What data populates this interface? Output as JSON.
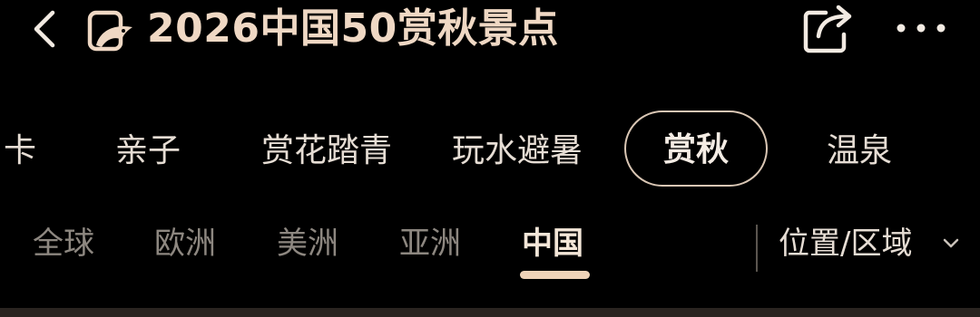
{
  "header": {
    "title": "2026中国50赏秋景点",
    "back_icon": "chevron-left-icon",
    "logo_icon": "dolphin-logo-icon",
    "share_icon": "share-icon",
    "more_icon": "more-horizontal-icon"
  },
  "category_tabs": [
    {
      "label": "卡"
    },
    {
      "label": "亲子"
    },
    {
      "label": "赏花踏青"
    },
    {
      "label": "玩水避暑"
    },
    {
      "label": "赏秋",
      "active": true
    },
    {
      "label": "温泉"
    }
  ],
  "region_tabs": [
    {
      "label": "全球"
    },
    {
      "label": "欧洲"
    },
    {
      "label": "美洲"
    },
    {
      "label": "亚洲"
    },
    {
      "label": "中国",
      "active": true
    }
  ],
  "filter": {
    "location_label": "位置/区域",
    "chevron_icon": "chevron-down-icon"
  },
  "colors": {
    "background": "#000000",
    "title": "#efd8c4",
    "accent": "#efd3b8",
    "inactive_text": "#8d8780"
  }
}
